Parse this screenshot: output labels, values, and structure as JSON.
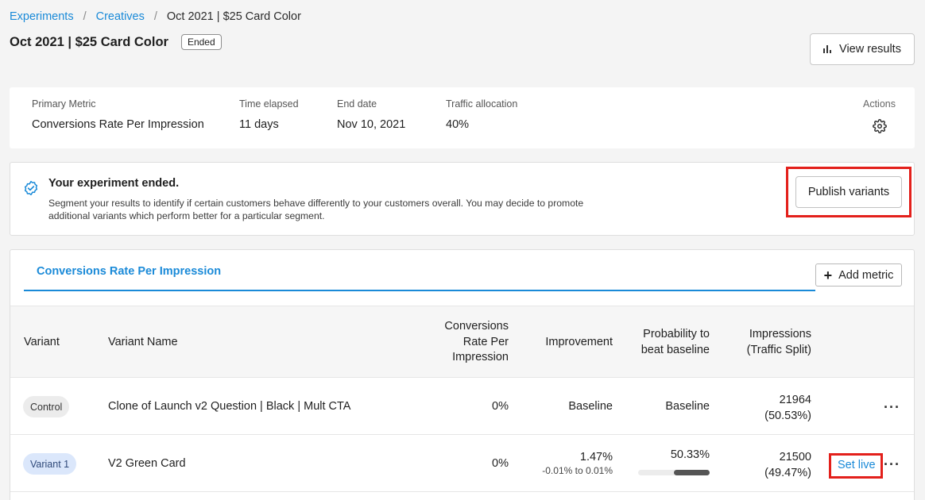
{
  "breadcrumb": {
    "items": [
      "Experiments",
      "Creatives"
    ],
    "separator": "/",
    "current": "Oct 2021 | $25 Card Color"
  },
  "header": {
    "title": "Oct 2021 | $25 Card Color",
    "status": "Ended",
    "view_results_label": "View results"
  },
  "summary": {
    "primary_metric_label": "Primary Metric",
    "primary_metric_value": "Conversions Rate Per Impression",
    "time_elapsed_label": "Time elapsed",
    "time_elapsed_value": "11 days",
    "end_date_label": "End date",
    "end_date_value": "Nov 10, 2021",
    "traffic_label": "Traffic allocation",
    "traffic_value": "40%",
    "actions_label": "Actions",
    "actions_icon": "gear-icon"
  },
  "notice": {
    "icon": "check-badge-icon",
    "title": "Your experiment ended.",
    "body": "Segment your results to identify if certain customers behave differently to your customers overall. You may decide to promote additional variants which perform better for a particular segment.",
    "publish_label": "Publish variants"
  },
  "results": {
    "tab_label": "Conversions Rate Per Impression",
    "add_metric_label": "Add metric",
    "columns": {
      "variant": "Variant",
      "variant_name": "Variant Name",
      "conversions": "Conversions Rate Per Impression",
      "improvement": "Improvement",
      "probability": "Probability to beat baseline",
      "impressions": "Impressions (Traffic Split)"
    },
    "rows": [
      {
        "variant": "Control",
        "name": "Clone of Launch v2 Question | Black | Mult CTA",
        "conversions": "0%",
        "improvement": "Baseline",
        "probability": "Baseline",
        "impressions": "21964",
        "split": "(50.53%)"
      },
      {
        "variant": "Variant 1",
        "name": "V2 Green Card",
        "conversions": "0%",
        "improvement": "1.47%",
        "improvement_range": "-0.01% to 0.01%",
        "probability": "50.33%",
        "probability_bar": {
          "start": 0.5,
          "end": 1.0
        },
        "impressions": "21500",
        "split": "(49.47%)",
        "action_label": "Set live"
      }
    ]
  },
  "colors": {
    "accent": "#1a8ad8",
    "highlight": "#e3201b",
    "control_pill": "#ececec",
    "variant_pill": "#dbe7fb"
  }
}
